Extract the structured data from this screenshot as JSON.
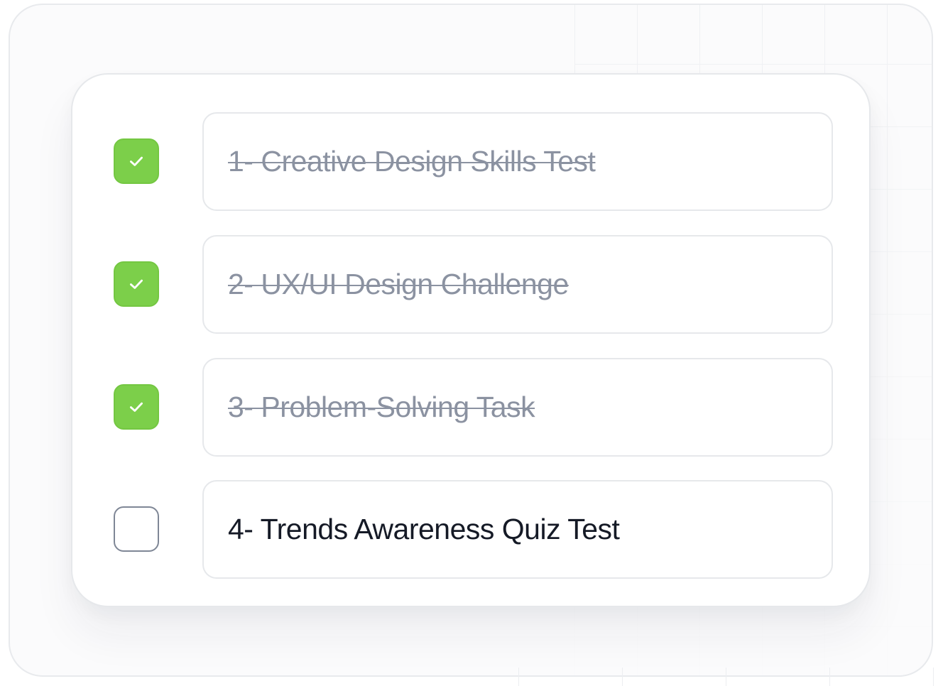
{
  "theme": {
    "check_color": "#7ccf4a",
    "done_text_color": "#8b92a1",
    "pending_text_color": "#151a26",
    "border_color": "#e6e8eb",
    "unchecked_border_color": "#7f8796"
  },
  "tasks": [
    {
      "label": "1- Creative Design Skills Test",
      "checked": true,
      "icon": "check-icon"
    },
    {
      "label": "2- UX/UI Design Challenge",
      "checked": true,
      "icon": "check-icon"
    },
    {
      "label": "3- Problem-Solving Task",
      "checked": true,
      "icon": "check-icon"
    },
    {
      "label": "4- Trends Awareness Quiz Test",
      "checked": false,
      "icon": ""
    }
  ]
}
